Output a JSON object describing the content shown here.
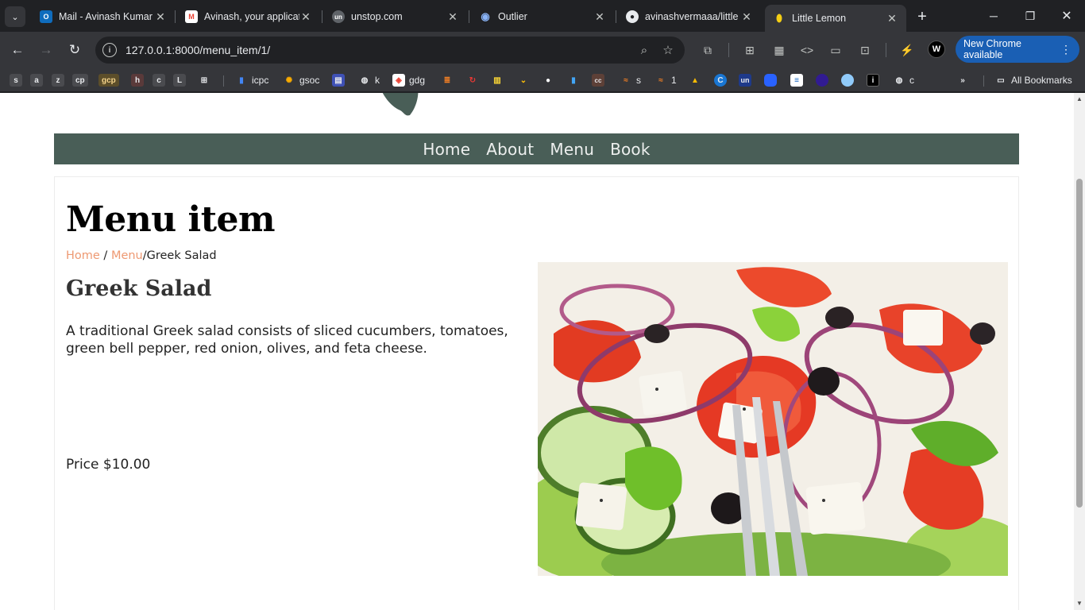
{
  "browser": {
    "tabs": [
      {
        "title": "Mail - Avinash Kumar",
        "favicon": "outlook-icon",
        "color": "#0f6cbd",
        "glyph": "O"
      },
      {
        "title": "Avinash, your applicati",
        "favicon": "gmail-icon",
        "color": "#ea4335",
        "glyph": "M"
      },
      {
        "title": "unstop.com",
        "favicon": "unstop-icon",
        "color": "#5f6368",
        "glyph": "un"
      },
      {
        "title": "Outlier",
        "favicon": "outlier-icon",
        "color": "#8ab4f8",
        "glyph": "◉"
      },
      {
        "title": "avinashvermaaa/little",
        "favicon": "github-icon",
        "color": "#202124",
        "glyph": "●"
      },
      {
        "title": "Little Lemon",
        "favicon": "lemon-icon",
        "color": "#f4ce14",
        "glyph": "●"
      }
    ],
    "url": "127.0.0.1:8000/menu_item/1/",
    "update_label": "New Chrome available",
    "profile_initial": "W",
    "bookmarks": [
      {
        "label": "",
        "glyph": "s"
      },
      {
        "label": "",
        "glyph": "a"
      },
      {
        "label": "",
        "glyph": "z"
      },
      {
        "label": "",
        "glyph": "cp"
      },
      {
        "label": "",
        "glyph": "gcp"
      },
      {
        "label": "",
        "glyph": "h"
      },
      {
        "label": "",
        "glyph": "c"
      },
      {
        "label": "",
        "glyph": "L"
      },
      {
        "label": "icpc",
        "glyph": "▮"
      },
      {
        "label": "gsoc",
        "glyph": "✺"
      },
      {
        "label": "k",
        "glyph": "◍"
      },
      {
        "label": "gdg",
        "glyph": "◈"
      },
      {
        "label": "s",
        "glyph": "≈"
      },
      {
        "label": "1",
        "glyph": "≈"
      },
      {
        "label": "un",
        "glyph": ""
      },
      {
        "label": "c",
        "glyph": "◍"
      }
    ],
    "all_bookmarks_label": "All Bookmarks"
  },
  "site": {
    "nav": [
      "Home",
      "About",
      "Menu",
      "Book"
    ],
    "page_title": "Menu item",
    "breadcrumb": {
      "home": "Home",
      "sep": " / ",
      "menu": "Menu",
      "current": "/Greek Salad"
    },
    "item": {
      "name": "Greek Salad",
      "description": "A traditional Greek salad consists of sliced cucumbers, tomatoes, green bell pepper, red onion, olives, and feta cheese.",
      "price": "Price $10.00"
    },
    "brand_color": "#495e57",
    "accent_color": "#ee9972"
  }
}
